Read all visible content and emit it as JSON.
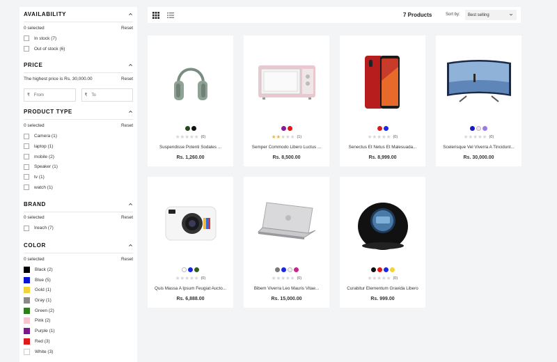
{
  "filters": {
    "availability": {
      "title": "AVAILABILITY",
      "selected": "0 selected",
      "reset": "Reset",
      "options": [
        "In stock (7)",
        "Out of stock (6)"
      ]
    },
    "price": {
      "title": "PRICE",
      "highest": "The highest price is Rs. 30,000.00",
      "reset": "Reset",
      "currency": "₹",
      "from_placeholder": "From",
      "to_placeholder": "To"
    },
    "product_type": {
      "title": "PRODUCT TYPE",
      "selected": "0 selected",
      "reset": "Reset",
      "options": [
        "Camera (1)",
        "laptop (1)",
        "mobile (2)",
        "Speaker (1)",
        "tv (1)",
        "watch (1)"
      ]
    },
    "brand": {
      "title": "BRAND",
      "selected": "0 selected",
      "reset": "Reset",
      "options": [
        "Ireach (7)"
      ]
    },
    "color": {
      "title": "COLOR",
      "selected": "0 selected",
      "reset": "Reset",
      "options": [
        {
          "label": "Black (2)",
          "hex": "#000000"
        },
        {
          "label": "Blue (5)",
          "hex": "#0a14d4"
        },
        {
          "label": "Gold (1)",
          "hex": "#f2d33a"
        },
        {
          "label": "Gray (1)",
          "hex": "#8a8a8a"
        },
        {
          "label": "Green (2)",
          "hex": "#2f7d1e"
        },
        {
          "label": "Pink (2)",
          "hex": "#f5c6cf"
        },
        {
          "label": "Purple (1)",
          "hex": "#7a1a8a"
        },
        {
          "label": "Red (3)",
          "hex": "#e01a1a"
        },
        {
          "label": "White (3)",
          "hex": "#ffffff"
        }
      ]
    }
  },
  "toolbar": {
    "product_count": "7 Products",
    "sort_label": "Sort by:",
    "sort_value": "Best selling"
  },
  "products": [
    {
      "name": "Suspendisse Potenti Sodales ...",
      "price": "Rs. 1,260.00",
      "rating": 0,
      "reviews": "(0)",
      "colors": [
        "#244a1c",
        "#111111"
      ],
      "image": "headphones"
    },
    {
      "name": "Semper Commodo Libero Luctus ...",
      "price": "Rs. 8,500.00",
      "rating": 2,
      "reviews": "(1)",
      "colors": [
        "#8b1a9a",
        "#e01a1a"
      ],
      "image": "microwave"
    },
    {
      "name": "Senectus Et Netus Et Malesuada...",
      "price": "Rs. 8,999.00",
      "rating": 0,
      "reviews": "(0)",
      "colors": [
        "#e01a1a",
        "#1a28e0"
      ],
      "image": "mobile"
    },
    {
      "name": "Scelerisque Vel Viverra A Tincidunt...",
      "price": "Rs. 30,000.00",
      "rating": 0,
      "reviews": "(0)",
      "colors": [
        "#1a18c8",
        "#f6dfe6",
        "#9a7ae6"
      ],
      "image": "tv"
    },
    {
      "name": "Quis Massa A Ipsum Feugiat Aucto...",
      "price": "Rs. 6,888.00",
      "rating": 0,
      "reviews": "(0)",
      "colors": [
        "#ffffff",
        "#1a28e0",
        "#2f5f1e"
      ],
      "image": "camera"
    },
    {
      "name": "Bibem Viverra Leo Mauris Vitae...",
      "price": "Rs. 15,000.00",
      "rating": 0,
      "reviews": "(0)",
      "colors": [
        "#7a7a7a",
        "#1a28e0",
        "#f0f0f0",
        "#c22a8a"
      ],
      "image": "laptop"
    },
    {
      "name": "Curabitur Elementum Gravida Libero",
      "price": "Rs. 999.00",
      "rating": 0,
      "reviews": "(0)",
      "colors": [
        "#111111",
        "#e01a1a",
        "#1a28e0",
        "#f2d33a"
      ],
      "image": "speaker"
    }
  ]
}
